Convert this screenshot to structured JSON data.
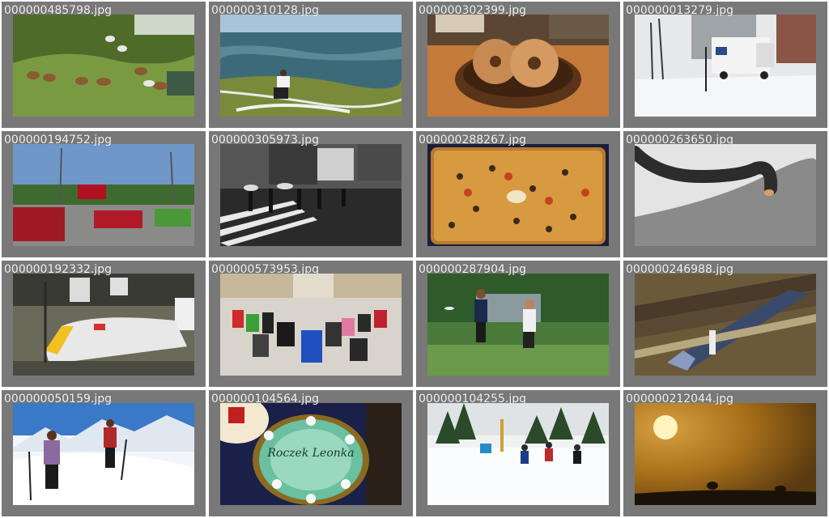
{
  "gallery": {
    "images": [
      {
        "filename": "000000485798.jpg",
        "scene": "ducks-on-grass"
      },
      {
        "filename": "000000310128.jpg",
        "scene": "surfer"
      },
      {
        "filename": "000000302399.jpg",
        "scene": "donuts-bowl"
      },
      {
        "filename": "000000013279.jpg",
        "scene": "snow-mail-truck"
      },
      {
        "filename": "000000194752.jpg",
        "scene": "street-cars"
      },
      {
        "filename": "000000305973.jpg",
        "scene": "bw-crosswalk"
      },
      {
        "filename": "000000288267.jpg",
        "scene": "pizza"
      },
      {
        "filename": "000000263650.jpg",
        "scene": "elephant-trunk"
      },
      {
        "filename": "000000192332.jpg",
        "scene": "train-station"
      },
      {
        "filename": "000000573953.jpg",
        "scene": "luggage-hall"
      },
      {
        "filename": "000000287904.jpg",
        "scene": "frisbee-players"
      },
      {
        "filename": "000000246988.jpg",
        "scene": "model-train"
      },
      {
        "filename": "000000050159.jpg",
        "scene": "ski-tourers"
      },
      {
        "filename": "000000104564.jpg",
        "scene": "cake"
      },
      {
        "filename": "000000104255.jpg",
        "scene": "ski-race"
      },
      {
        "filename": "000000212044.jpg",
        "scene": "sunset-silhouettes"
      }
    ]
  },
  "cake_text": "Roczek Leonka",
  "colors": {
    "cell_background": "#787878",
    "label_text": "#f4f4f4",
    "page_background": "#ffffff"
  }
}
